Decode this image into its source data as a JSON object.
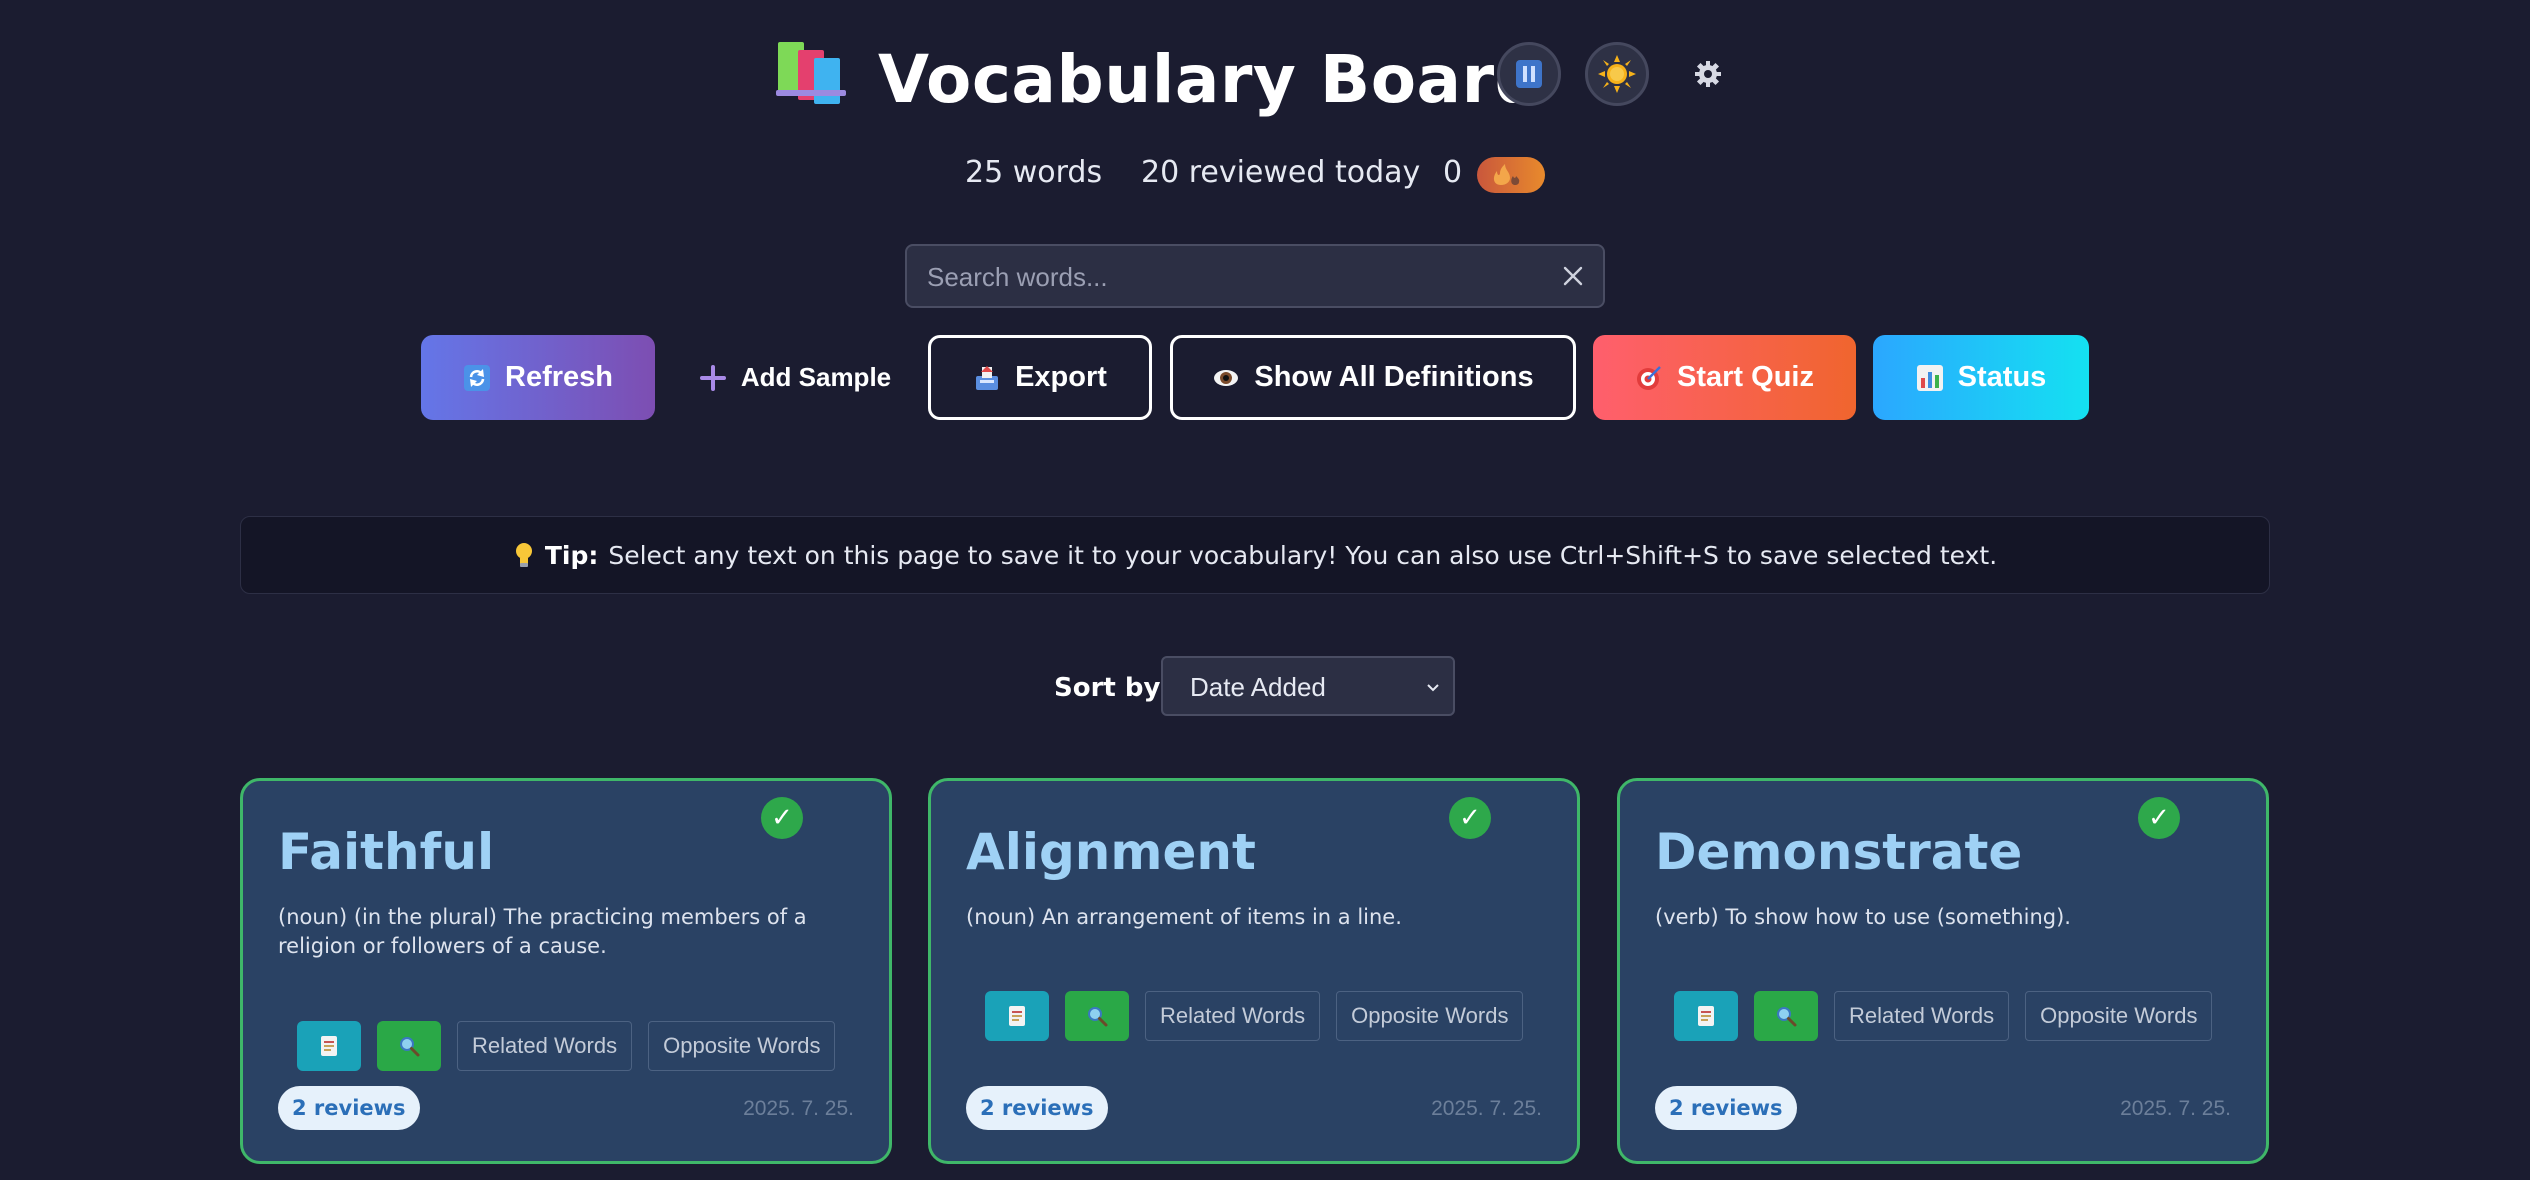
{
  "header": {
    "title": "Vocabulary Board",
    "logo_icon": "books-icon",
    "pause_icon": "pause-icon",
    "theme_icon": "sun-icon",
    "settings_icon": "gear-icon"
  },
  "stats": {
    "words": "25 words",
    "reviewed": "20 reviewed today",
    "streak": "0",
    "streak_icon": "fire-icon"
  },
  "search": {
    "placeholder": "Search words...",
    "value": ""
  },
  "actions": {
    "refresh": "Refresh",
    "add_sample": "Add Sample",
    "export": "Export",
    "show_definitions": "Show All Definitions",
    "start_quiz": "Start Quiz",
    "status": "Status"
  },
  "tip": {
    "label": "Tip:",
    "text": "Select any text on this page to save it to your vocabulary! You can also use Ctrl+Shift+S to save selected text."
  },
  "sort": {
    "label": "Sort by:",
    "selected": "Date Added"
  },
  "cards": [
    {
      "word": "Faithful",
      "definition": "(noun) (in the plural) The practicing members of a religion or followers of a cause.",
      "related": "Related Words",
      "opposite": "Opposite Words",
      "reviews": "2 reviews",
      "date": "2025. 7. 25.",
      "check": "✓"
    },
    {
      "word": "Alignment",
      "definition": "(noun) An arrangement of items in a line.",
      "related": "Related Words",
      "opposite": "Opposite Words",
      "reviews": "2 reviews",
      "date": "2025. 7. 25.",
      "check": "✓"
    },
    {
      "word": "Demonstrate",
      "definition": "(verb) To show how to use (something).",
      "related": "Related Words",
      "opposite": "Opposite Words",
      "reviews": "2 reviews",
      "date": "2025. 7. 25.",
      "check": "✓"
    }
  ],
  "colors": {
    "background": "#1b1c30",
    "card_bg": "#2a4264",
    "card_border": "#3fb769",
    "word_color": "#9fd1f5",
    "refresh_gradient": [
      "#6476e8",
      "#7d4eb2"
    ],
    "quiz_gradient": [
      "#ff5f6d",
      "#f0652e"
    ],
    "status_gradient": [
      "#2ba7ff",
      "#14e1f1"
    ]
  }
}
